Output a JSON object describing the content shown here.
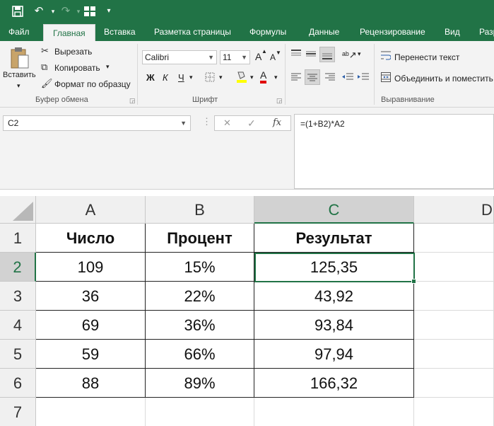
{
  "quick_access": {
    "icons": [
      "save-icon",
      "undo-icon",
      "undo-dropdown-icon",
      "redo-icon",
      "redo-dropdown-icon",
      "form-icon",
      "customize-icon"
    ]
  },
  "ribbon_tabs": [
    "Файл",
    "Главная",
    "Вставка",
    "Разметка страницы",
    "Формулы",
    "Данные",
    "Рецензирование",
    "Вид",
    "Разр"
  ],
  "active_tab": "Главная",
  "clipboard": {
    "paste": "Вставить",
    "cut": "Вырезать",
    "copy": "Копировать",
    "format_painter": "Формат по образцу",
    "group": "Буфер обмена"
  },
  "font": {
    "name": "Calibri",
    "size": "11",
    "grow": "A",
    "shrink": "A",
    "bold": "Ж",
    "italic": "К",
    "underline": "Ч",
    "font_color_letter": "A",
    "group": "Шрифт"
  },
  "alignment": {
    "wrap_text": "Перенести текст",
    "merge_center": "Объединить и поместить",
    "group": "Выравнивание"
  },
  "formula_bar": {
    "name_box": "C2",
    "cancel": "✕",
    "enter": "✓",
    "fx": "fx",
    "formula": "=(1+B2)*A2"
  },
  "sheet": {
    "columns": [
      "A",
      "B",
      "C",
      "D"
    ],
    "rows": [
      "1",
      "2",
      "3",
      "4",
      "5",
      "6",
      "7"
    ],
    "header": [
      "Число",
      "Процент",
      "Результат"
    ],
    "data": [
      [
        "109",
        "15%",
        "125,35"
      ],
      [
        "36",
        "22%",
        "43,92"
      ],
      [
        "69",
        "36%",
        "93,84"
      ],
      [
        "59",
        "66%",
        "97,94"
      ],
      [
        "88",
        "89%",
        "166,32"
      ]
    ],
    "selected_cell": "C2"
  },
  "colors": {
    "accent": "#217346",
    "selected_header_bg": "#d2d2d2",
    "ribbon_bg": "#f3f3f3"
  }
}
